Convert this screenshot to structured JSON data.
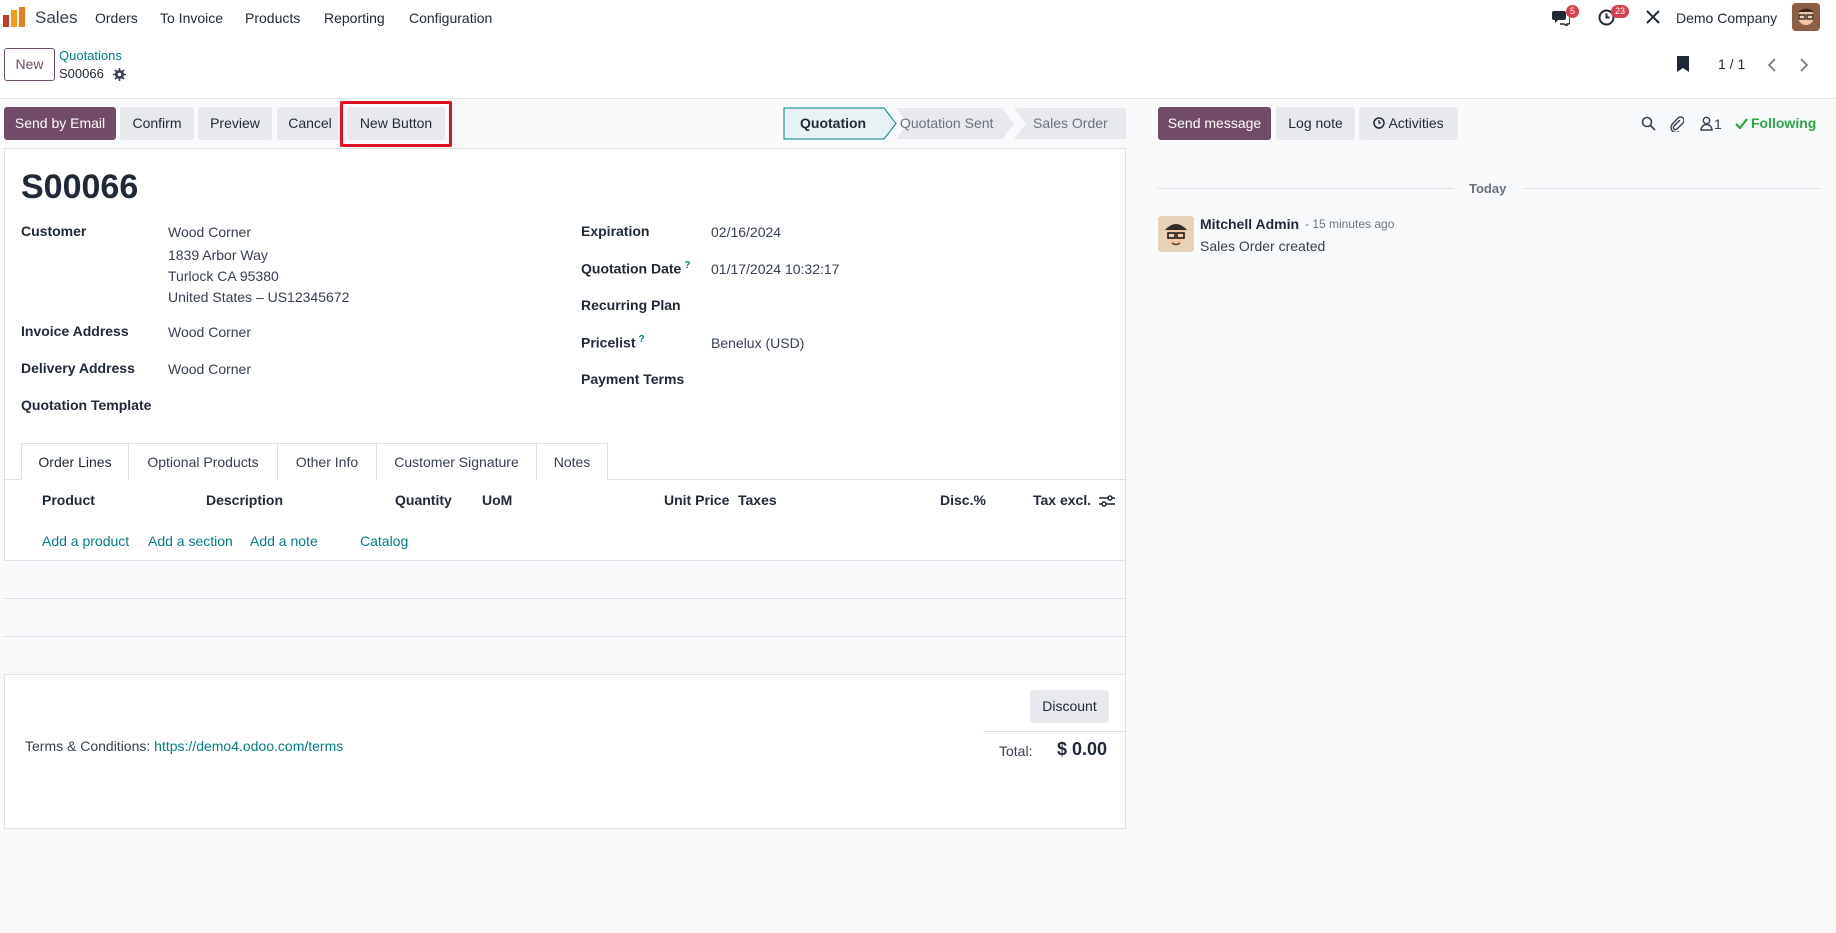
{
  "nav": {
    "app_name": "Sales",
    "menu": [
      "Orders",
      "To Invoice",
      "Products",
      "Reporting",
      "Configuration"
    ],
    "messages_badge": "5",
    "activities_badge": "23",
    "company": "Demo Company"
  },
  "control_panel": {
    "new_label": "New",
    "breadcrumb_parent": "Quotations",
    "breadcrumb_current": "S00066",
    "pager": "1 / 1"
  },
  "actions": {
    "send_by_email": "Send by Email",
    "confirm": "Confirm",
    "preview": "Preview",
    "cancel": "Cancel",
    "new_button": "New Button"
  },
  "statusbar": [
    "Quotation",
    "Quotation Sent",
    "Sales Order"
  ],
  "form": {
    "title": "S00066",
    "customer_label": "Customer",
    "customer_name": "Wood Corner",
    "customer_addr1": "1839 Arbor Way",
    "customer_addr2": "Turlock CA 95380",
    "customer_addr3": "United States – US12345672",
    "invoice_address_label": "Invoice Address",
    "invoice_address": "Wood Corner",
    "delivery_address_label": "Delivery Address",
    "delivery_address": "Wood Corner",
    "quotation_template_label": "Quotation Template",
    "expiration_label": "Expiration",
    "expiration": "02/16/2024",
    "quotation_date_label": "Quotation Date",
    "quotation_date": "01/17/2024 10:32:17",
    "recurring_plan_label": "Recurring Plan",
    "pricelist_label": "Pricelist",
    "pricelist": "Benelux (USD)",
    "payment_terms_label": "Payment Terms",
    "help_mark": "?"
  },
  "tabs": [
    "Order Lines",
    "Optional Products",
    "Other Info",
    "Customer Signature",
    "Notes"
  ],
  "order_lines": {
    "columns": [
      "Product",
      "Description",
      "Quantity",
      "UoM",
      "Unit Price",
      "Taxes",
      "Disc.%",
      "Tax excl."
    ],
    "add_product": "Add a product",
    "add_section": "Add a section",
    "add_note": "Add a note",
    "catalog": "Catalog",
    "discount": "Discount",
    "total_label": "Total:",
    "total_value": "$ 0.00"
  },
  "terms": {
    "label": "Terms & Conditions:",
    "link": "https://demo4.odoo.com/terms"
  },
  "chatter": {
    "send_message": "Send message",
    "log_note": "Log note",
    "activities": "Activities",
    "followers_count": "1",
    "following": "Following",
    "today": "Today",
    "author": "Mitchell Admin",
    "time": "- 15 minutes ago",
    "message": "Sales Order created"
  },
  "colors": {
    "primary": "#714b67",
    "link": "#017e84",
    "highlight": "#e0101f",
    "following": "#28a745"
  }
}
